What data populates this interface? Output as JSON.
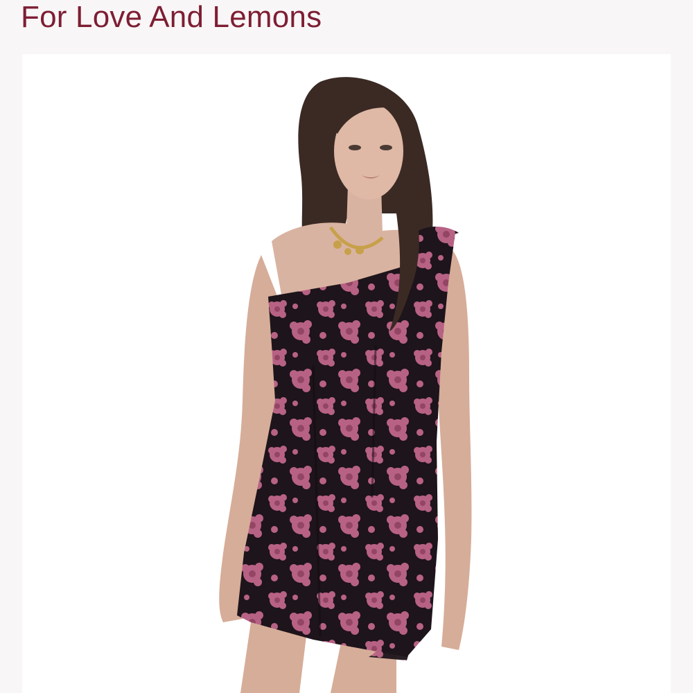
{
  "header": {
    "brand": "For Love And Lemons"
  },
  "product_image": {
    "alt": "Model wearing a black one-shoulder mini dress with pink floral print",
    "colors": {
      "background": "#ffffff",
      "dress": "#1e141b",
      "floral_print": "#c86a8f",
      "hair": "#3b2a24",
      "skin": "#d9b3a1",
      "necklace": "#c7a04a",
      "brand_text": "#7d1e33"
    }
  }
}
